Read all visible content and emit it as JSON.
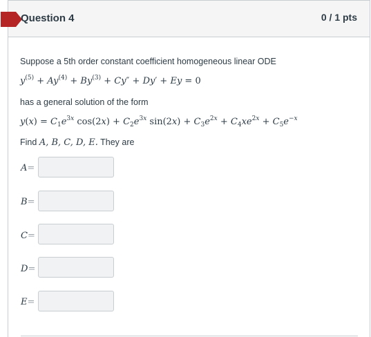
{
  "question": {
    "title": "Question 4",
    "points": "0 / 1 pts"
  },
  "body": {
    "intro": "Suppose a 5th order constant coefficient homogeneous linear ODE",
    "ode": "y(5) + Ay(4) + By(3) + Cy″ + Dy′ + Ey = 0",
    "mid_text": "has a general solution of the form",
    "solution": "y(x) = C1e3x cos(2x) + C2e3x sin(2x) + C3e2x + C4xe2x + C5e−x",
    "find_prefix": "Find",
    "find_vars": "A, B, C, D, E.",
    "find_suffix": "They are"
  },
  "answers": [
    {
      "label": "A",
      "value": ""
    },
    {
      "label": "B",
      "value": ""
    },
    {
      "label": "C",
      "value": ""
    },
    {
      "label": "D",
      "value": ""
    },
    {
      "label": "E",
      "value": ""
    }
  ],
  "colors": {
    "flag": "#b52525",
    "header_bg": "#f5f5f5",
    "border": "#c7cdd1",
    "text": "#2d3b45"
  }
}
